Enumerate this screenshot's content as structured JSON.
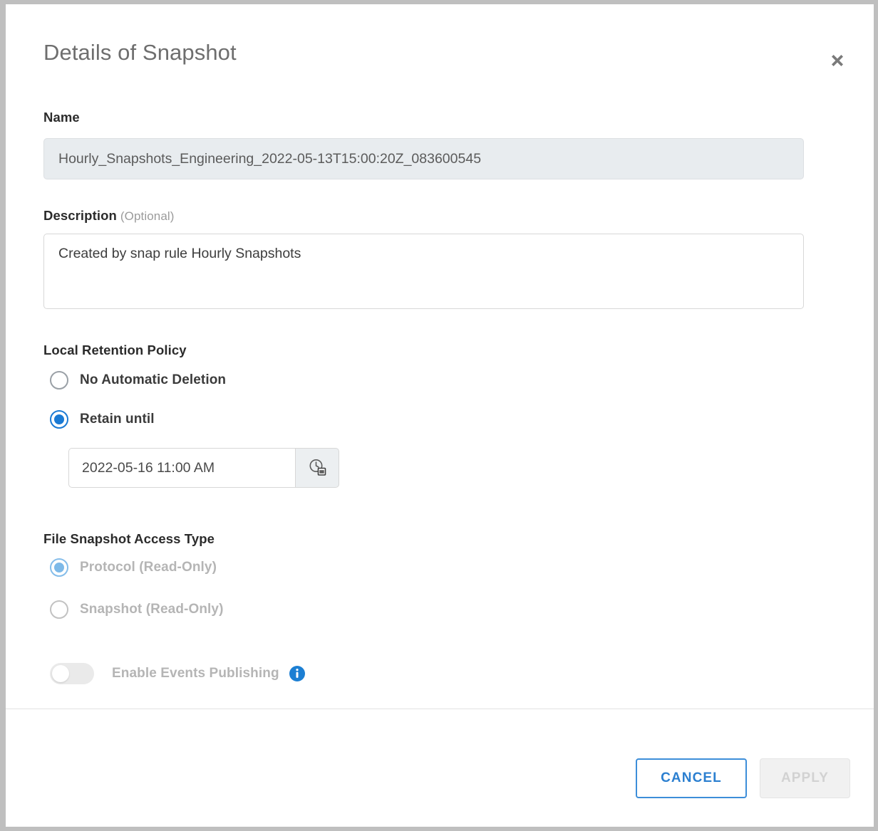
{
  "dialog": {
    "title": "Details of Snapshot",
    "close_icon": "close-icon"
  },
  "name_field": {
    "label": "Name",
    "value": "Hourly_Snapshots_Engineering_2022-05-13T15:00:20Z_083600545",
    "placeholder": ""
  },
  "description_field": {
    "label": "Description",
    "optional_tag": "(Optional)",
    "value": "Created by snap rule Hourly Snapshots",
    "placeholder": ""
  },
  "local_retention_policy": {
    "label": "Local Retention Policy",
    "options": [
      {
        "label": "No Automatic Deletion",
        "selected": false
      },
      {
        "label": "Retain until",
        "selected": true
      }
    ],
    "date_value": "2022-05-16 11:00 AM",
    "date_placeholder": "",
    "date_picker_icon": "calendar-clock-icon"
  },
  "file_snapshot_access_type": {
    "label": "File Snapshot Access Type",
    "options": [
      {
        "label": "Protocol (Read-Only)",
        "selected": true
      },
      {
        "label": "Snapshot (Read-Only)",
        "selected": false
      }
    ]
  },
  "events_publishing": {
    "label": "Enable Events Publishing",
    "toggle_state": "off",
    "info_icon": "info-icon"
  },
  "footer": {
    "cancel_label": "CANCEL",
    "apply_label": "APPLY"
  },
  "colors": {
    "accent_blue": "#1a7ad4",
    "cancel_border": "#3d8ed9",
    "disabled_text": "#b5b5b5",
    "name_field_bg": "#e8ecef",
    "info_blue": "#1c7fd3"
  }
}
